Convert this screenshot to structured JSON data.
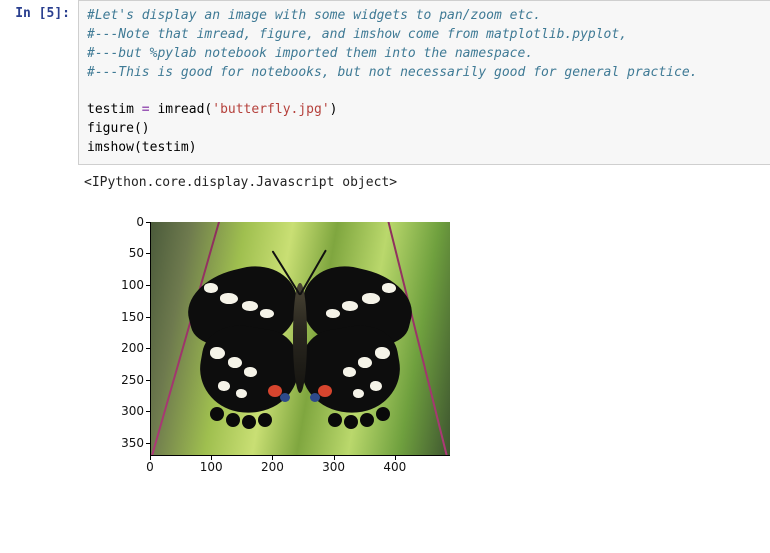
{
  "cell": {
    "prompt_label": "In [5]:",
    "code": {
      "comment1": "#Let's display an image with some widgets to pan/zoom etc.",
      "comment2": "#---Note that imread, figure, and imshow come from matplotlib.pyplot,",
      "comment3": "#---but %pylab notebook imported them into the namespace.",
      "comment4": "#---This is good for notebooks, but not necessarily good for general practice.",
      "line5_a": "testim ",
      "line5_op": "=",
      "line5_b": " imread(",
      "line5_str": "'butterfly.jpg'",
      "line5_c": ")",
      "line6": "figure()",
      "line7": "imshow(testim)"
    }
  },
  "output": {
    "text": "<IPython.core.display.Javascript object>"
  },
  "chart_data": {
    "type": "image",
    "description": "matplotlib imshow of butterfly.jpg (black swallowtail butterfly on green leaf)",
    "x_ticks": [
      0,
      100,
      200,
      300,
      400
    ],
    "y_ticks": [
      0,
      50,
      100,
      150,
      200,
      250,
      300,
      350
    ],
    "xlim": [
      0,
      490
    ],
    "ylim": [
      370,
      0
    ],
    "title": "",
    "xlabel": "",
    "ylabel": ""
  }
}
